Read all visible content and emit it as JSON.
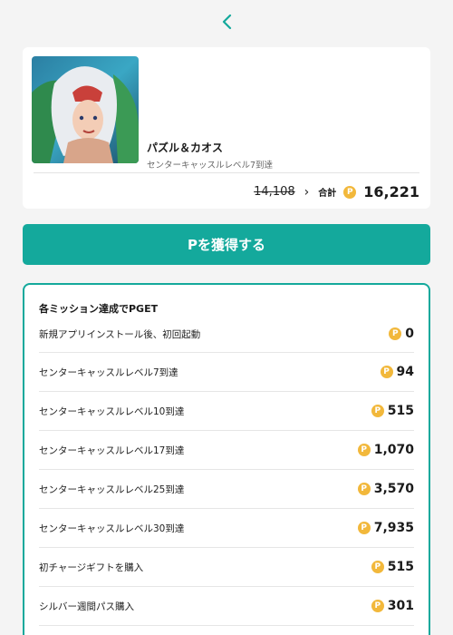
{
  "nav": {
    "back_icon": "chevron-left-icon"
  },
  "app": {
    "title": "パズル＆カオス",
    "subtitle": "センターキャッスルレベル7到達",
    "old_price": "14,108",
    "total_label": "合計",
    "total_value": "16,221"
  },
  "coin_symbol": "P",
  "action": {
    "label": "Pを獲得する"
  },
  "missions": {
    "header": "各ミッション達成でPGET",
    "items": [
      {
        "label": "新規アプリインストール後、初回起動",
        "value": "0"
      },
      {
        "label": "センターキャッスルレベル7到達",
        "value": "94"
      },
      {
        "label": "センターキャッスルレベル10到達",
        "value": "515"
      },
      {
        "label": "センターキャッスルレベル17到達",
        "value": "1,070"
      },
      {
        "label": "センターキャッスルレベル25到達",
        "value": "3,570"
      },
      {
        "label": "センターキャッスルレベル30到達",
        "value": "7,935"
      },
      {
        "label": "初チャージギフトを購入",
        "value": "515"
      },
      {
        "label": "シルバー週間パス購入",
        "value": "301"
      }
    ]
  },
  "colors": {
    "accent": "#14a99c",
    "coin": "#f2b83b",
    "background": "#f4f4f4"
  }
}
